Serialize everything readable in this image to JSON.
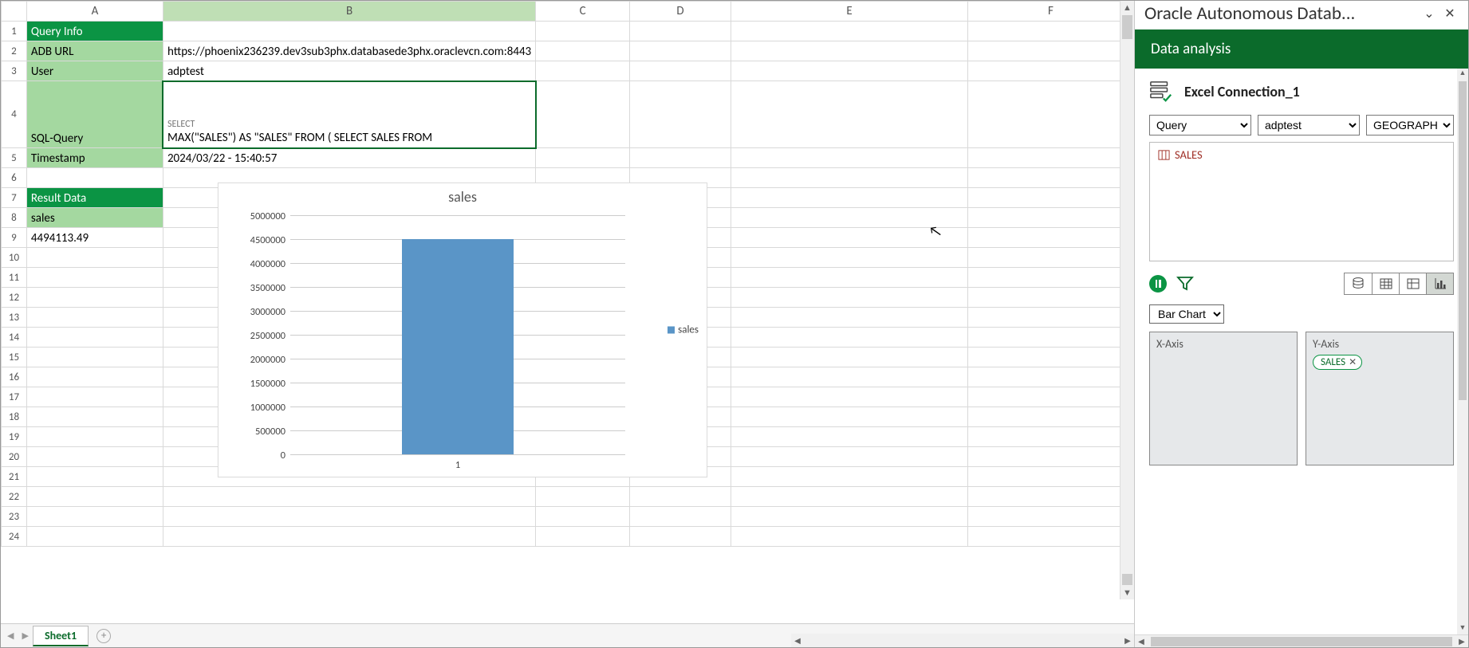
{
  "columns": [
    "A",
    "B",
    "C",
    "D",
    "E",
    "F"
  ],
  "row_labels": [
    "1",
    "2",
    "3",
    "4",
    "5",
    "6",
    "7",
    "8",
    "9",
    "10",
    "11",
    "12",
    "13",
    "14",
    "15",
    "16",
    "17",
    "18",
    "19",
    "20",
    "21",
    "22",
    "23",
    "24"
  ],
  "cells": {
    "A1": "Query Info",
    "A2": "ADB URL",
    "B2": "https://phoenix236239.dev3sub3phx.databasede3phx.oraclevcn.com:8443",
    "A3": "User",
    "B3": "adptest",
    "A4": "SQL-Query",
    "B4": "MAX(\"SALES\") AS \"SALES\" FROM ( SELECT SALES FROM",
    "B4_pre": "SELECT",
    "A5": "Timestamp",
    "B5": "2024/03/22 - 15:40:57",
    "A7": "Result Data",
    "A8": "sales",
    "A9": "4494113.49"
  },
  "chart_data": {
    "type": "bar",
    "title": "sales",
    "categories": [
      "1"
    ],
    "series": [
      {
        "name": "sales",
        "values": [
          4494113.49
        ]
      }
    ],
    "ylim": [
      0,
      5000000
    ],
    "y_ticks": [
      "0",
      "500000",
      "1000000",
      "1500000",
      "2000000",
      "2500000",
      "3000000",
      "3500000",
      "4000000",
      "4500000",
      "5000000"
    ],
    "xlabel": "",
    "ylabel": "",
    "legend": [
      "sales"
    ]
  },
  "sheet_tabs": {
    "active": "Sheet1"
  },
  "panel": {
    "header_title": "Oracle Autonomous Datab...",
    "band_title": "Data analysis",
    "connection_name": "Excel Connection_1",
    "dropdowns": {
      "mode": [
        "Query"
      ],
      "schema": [
        "adptest"
      ],
      "table": [
        "GEOGRAPHY_D"
      ]
    },
    "field_items": [
      "SALES"
    ],
    "chart_type_options": [
      "Bar Chart"
    ],
    "x_axis_label": "X-Axis",
    "y_axis_label": "Y-Axis",
    "y_axis_pills": [
      "SALES"
    ]
  }
}
